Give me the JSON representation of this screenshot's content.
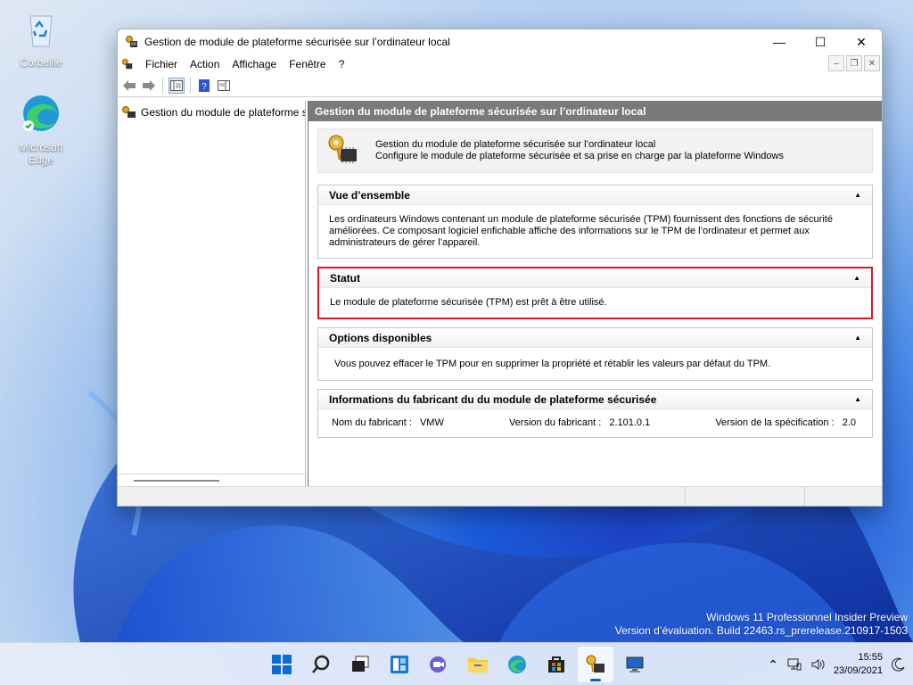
{
  "desktop": {
    "recycle_bin_label": "Corbeille",
    "edge_label": "Microsoft Edge",
    "watermark_line1": "Windows 11 Professionnel Insider Preview",
    "watermark_line2": "Version d’évaluation. Build 22463.rs_prerelease.210917-1503"
  },
  "window": {
    "title": "Gestion de module de plateforme sécurisée sur l’ordinateur local",
    "menu": [
      "Fichier",
      "Action",
      "Affichage",
      "Fenêtre",
      "?"
    ],
    "tree_item": "Gestion du module de plateforme sécurisée",
    "content_header": "Gestion du module de plateforme sécurisée sur l’ordinateur local",
    "intro_line1": "Gestion du module de plateforme sécurisée sur l’ordinateur local",
    "intro_line2": "Configure le module de plateforme sécurisée et sa prise en charge par la plateforme Windows"
  },
  "sections": {
    "overview": {
      "title": "Vue d’ensemble",
      "text": "Les ordinateurs Windows contenant un module de plateforme sécurisée (TPM) fournissent des fonctions de sécurité améliorées. Ce composant logiciel enfichable affiche des informations sur le TPM de l’ordinateur et permet aux administrateurs de gérer l’appareil."
    },
    "status": {
      "title": "Statut",
      "text": "Le module de plateforme sécurisée (TPM) est prêt à être utilisé."
    },
    "options": {
      "title": "Options disponibles",
      "text": "Vous pouvez effacer le TPM pour en supprimer la propriété et rétablir les valeurs par défaut du TPM."
    },
    "manufacturer": {
      "title": "Informations du fabricant du du module de plateforme sécurisée",
      "name_label": "Nom du fabricant :",
      "name_value": "VMW",
      "version_label": "Version du fabricant :",
      "version_value": "2.101.0.1",
      "spec_label": "Version de la spécification :",
      "spec_value": "2.0"
    }
  },
  "taskbar": {
    "time": "15:55",
    "date": "23/09/2021"
  },
  "colors": {
    "highlight": "#e81123",
    "header_gray": "#7a7a7a",
    "accent": "#0067c0"
  }
}
